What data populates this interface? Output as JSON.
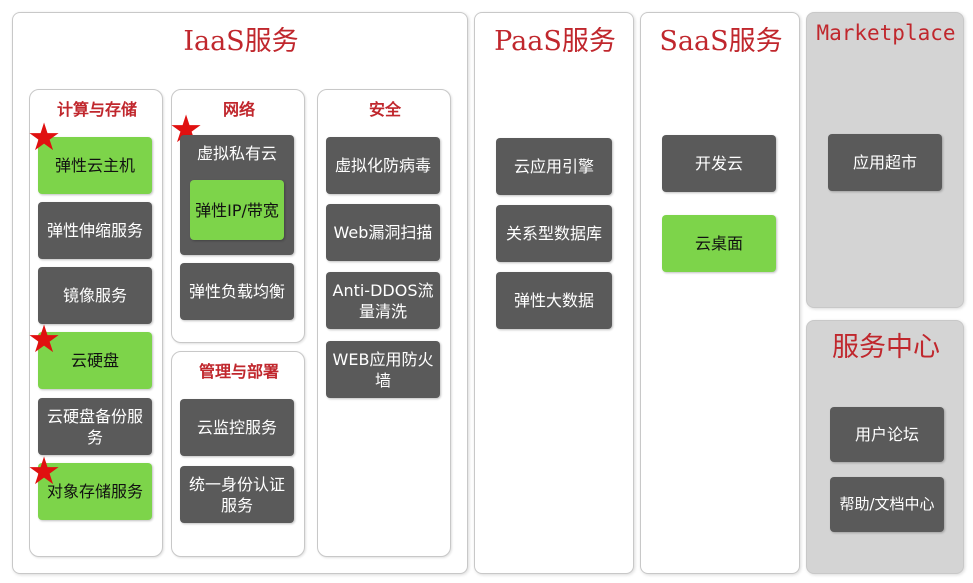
{
  "colors": {
    "title_red": "#c0272d",
    "dark_box": "#5a5a5a",
    "green_box": "#7dd44a",
    "gray_panel": "#d4d4d4",
    "star_red": "#e01010"
  },
  "iaas": {
    "title": "IaaS服务",
    "compute": {
      "title": "计算与存储",
      "items": [
        "弹性云主机",
        "弹性伸缩服务",
        "镜像服务",
        "云硬盘",
        "云硬盘备份服务",
        "对象存储服务"
      ]
    },
    "network": {
      "title": "网络",
      "vpc": "虚拟私有云",
      "eip": "弹性IP/带宽",
      "elb": "弹性负载均衡"
    },
    "management": {
      "title": "管理与部署",
      "items": [
        "云监控服务",
        "统一身份认证服务"
      ]
    },
    "security": {
      "title": "安全",
      "items": [
        "虚拟化防病毒",
        "Web漏洞扫描",
        "Anti-DDOS流量清洗",
        "WEB应用防火墙"
      ]
    }
  },
  "paas": {
    "title": "PaaS服务",
    "items": [
      "云应用引擎",
      "关系型数据库",
      "弹性大数据"
    ]
  },
  "saas": {
    "title": "SaaS服务",
    "items": [
      "开发云",
      "云桌面"
    ]
  },
  "marketplace": {
    "title": "Marketplace",
    "items": [
      "应用超市"
    ]
  },
  "service_center": {
    "title": "服务中心",
    "items": [
      "用户论坛",
      "帮助/文档中心"
    ]
  },
  "star_glyph": "★"
}
